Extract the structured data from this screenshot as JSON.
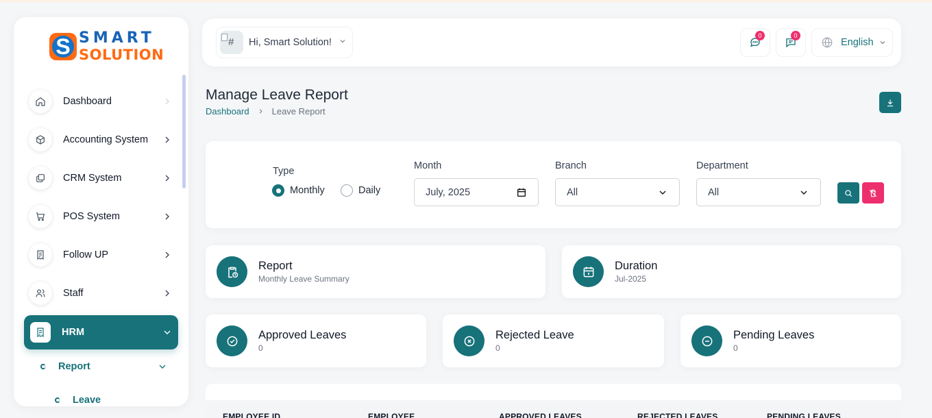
{
  "brand": {
    "line1": "SMART",
    "line2": "SOLUTION"
  },
  "sidebar": {
    "items": [
      {
        "label": "Dashboard"
      },
      {
        "label": "Accounting System"
      },
      {
        "label": "CRM System"
      },
      {
        "label": "POS System"
      },
      {
        "label": "Follow UP"
      },
      {
        "label": "Staff"
      },
      {
        "label": "HRM"
      }
    ],
    "sub": {
      "report": "Report",
      "leave": "Leave"
    }
  },
  "topbar": {
    "avatar_alt": "#",
    "greeting": "Hi, Smart Solution!",
    "messages_count": "0",
    "notifications_count": "0",
    "language": "English"
  },
  "page": {
    "title": "Manage Leave Report",
    "breadcrumb": [
      "Dashboard",
      "Leave Report"
    ]
  },
  "filters": {
    "type_label": "Type",
    "type_options": [
      "Monthly",
      "Daily"
    ],
    "type_selected": "Monthly",
    "month_label": "Month",
    "month_value": "July, 2025",
    "branch_label": "Branch",
    "branch_value": "All",
    "department_label": "Department",
    "department_value": "All"
  },
  "summary": [
    {
      "title": "Report",
      "sub": "Monthly Leave Summary"
    },
    {
      "title": "Duration",
      "sub": "Jul-2025"
    }
  ],
  "stats": [
    {
      "title": "Approved Leaves",
      "value": "0"
    },
    {
      "title": "Rejected Leave",
      "value": "0"
    },
    {
      "title": "Pending Leaves",
      "value": "0"
    }
  ],
  "table": {
    "headers": [
      "EMPLOYEE ID",
      "EMPLOYEE",
      "APPROVED LEAVES",
      "REJECTED LEAVES",
      "PENDING LEAVES"
    ]
  },
  "colors": {
    "primary": "#17727a",
    "danger": "#ed2f6e",
    "logo_orange": "#ff6a13",
    "logo_blue": "#1a63b8"
  }
}
